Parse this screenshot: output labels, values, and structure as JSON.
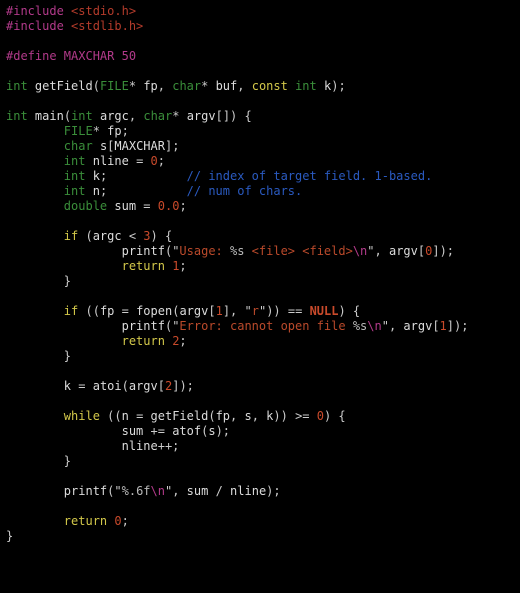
{
  "tokens": [
    [
      [
        "tok-pre",
        "#include "
      ],
      [
        "tok-inc",
        "<stdio.h>"
      ]
    ],
    [
      [
        "tok-pre",
        "#include "
      ],
      [
        "tok-inc",
        "<stdlib.h>"
      ]
    ],
    [],
    [
      [
        "tok-pre",
        "#define MAXCHAR 50"
      ]
    ],
    [],
    [
      [
        "tok-type",
        "int"
      ],
      [
        "tok-punc",
        " "
      ],
      [
        "tok-func",
        "getField"
      ],
      [
        "tok-punc",
        "("
      ],
      [
        "tok-type",
        "FILE"
      ],
      [
        "tok-punc",
        "* "
      ],
      [
        "tok-ident",
        "fp"
      ],
      [
        "tok-punc",
        ", "
      ],
      [
        "tok-type",
        "char"
      ],
      [
        "tok-punc",
        "* "
      ],
      [
        "tok-ident",
        "buf"
      ],
      [
        "tok-punc",
        ", "
      ],
      [
        "tok-kw",
        "const"
      ],
      [
        "tok-punc",
        " "
      ],
      [
        "tok-type",
        "int"
      ],
      [
        "tok-punc",
        " "
      ],
      [
        "tok-ident",
        "k"
      ],
      [
        "tok-punc",
        ");"
      ]
    ],
    [],
    [
      [
        "tok-type",
        "int"
      ],
      [
        "tok-punc",
        " "
      ],
      [
        "tok-func",
        "main"
      ],
      [
        "tok-punc",
        "("
      ],
      [
        "tok-type",
        "int"
      ],
      [
        "tok-punc",
        " "
      ],
      [
        "tok-ident",
        "argc"
      ],
      [
        "tok-punc",
        ", "
      ],
      [
        "tok-type",
        "char"
      ],
      [
        "tok-punc",
        "* "
      ],
      [
        "tok-ident",
        "argv"
      ],
      [
        "tok-punc",
        "[]) {"
      ]
    ],
    [
      [
        "tok-punc",
        "        "
      ],
      [
        "tok-type",
        "FILE"
      ],
      [
        "tok-punc",
        "* "
      ],
      [
        "tok-ident",
        "fp"
      ],
      [
        "tok-punc",
        ";"
      ]
    ],
    [
      [
        "tok-punc",
        "        "
      ],
      [
        "tok-type",
        "char"
      ],
      [
        "tok-punc",
        " "
      ],
      [
        "tok-ident",
        "s"
      ],
      [
        "tok-punc",
        "["
      ],
      [
        "tok-ident",
        "MAXCHAR"
      ],
      [
        "tok-punc",
        "];"
      ]
    ],
    [
      [
        "tok-punc",
        "        "
      ],
      [
        "tok-type",
        "int"
      ],
      [
        "tok-punc",
        " "
      ],
      [
        "tok-ident",
        "nline"
      ],
      [
        "tok-punc",
        " = "
      ],
      [
        "tok-num",
        "0"
      ],
      [
        "tok-punc",
        ";"
      ]
    ],
    [
      [
        "tok-punc",
        "        "
      ],
      [
        "tok-type",
        "int"
      ],
      [
        "tok-punc",
        " "
      ],
      [
        "tok-ident",
        "k"
      ],
      [
        "tok-punc",
        ";           "
      ],
      [
        "tok-cmt",
        "// index of target field. 1-based."
      ]
    ],
    [
      [
        "tok-punc",
        "        "
      ],
      [
        "tok-type",
        "int"
      ],
      [
        "tok-punc",
        " "
      ],
      [
        "tok-ident",
        "n"
      ],
      [
        "tok-punc",
        ";           "
      ],
      [
        "tok-cmt",
        "// num of chars."
      ]
    ],
    [
      [
        "tok-punc",
        "        "
      ],
      [
        "tok-type",
        "double"
      ],
      [
        "tok-punc",
        " "
      ],
      [
        "tok-ident",
        "sum"
      ],
      [
        "tok-punc",
        " = "
      ],
      [
        "tok-num",
        "0.0"
      ],
      [
        "tok-punc",
        ";"
      ]
    ],
    [],
    [
      [
        "tok-punc",
        "        "
      ],
      [
        "tok-kw",
        "if"
      ],
      [
        "tok-punc",
        " ("
      ],
      [
        "tok-ident",
        "argc"
      ],
      [
        "tok-punc",
        " < "
      ],
      [
        "tok-num",
        "3"
      ],
      [
        "tok-punc",
        ") {"
      ]
    ],
    [
      [
        "tok-punc",
        "                "
      ],
      [
        "tok-func",
        "printf"
      ],
      [
        "tok-punc",
        "("
      ],
      [
        "tok-strq",
        "\""
      ],
      [
        "tok-str",
        "Usage: "
      ],
      [
        "tok-fmt",
        "%s"
      ],
      [
        "tok-str",
        " <file> <field>"
      ],
      [
        "tok-esc",
        "\\n"
      ],
      [
        "tok-strq",
        "\""
      ],
      [
        "tok-punc",
        ", "
      ],
      [
        "tok-ident",
        "argv"
      ],
      [
        "tok-punc",
        "["
      ],
      [
        "tok-num",
        "0"
      ],
      [
        "tok-punc",
        "]);"
      ]
    ],
    [
      [
        "tok-punc",
        "                "
      ],
      [
        "tok-kw",
        "return"
      ],
      [
        "tok-punc",
        " "
      ],
      [
        "tok-num",
        "1"
      ],
      [
        "tok-punc",
        ";"
      ]
    ],
    [
      [
        "tok-punc",
        "        }"
      ]
    ],
    [],
    [
      [
        "tok-punc",
        "        "
      ],
      [
        "tok-kw",
        "if"
      ],
      [
        "tok-punc",
        " (("
      ],
      [
        "tok-ident",
        "fp"
      ],
      [
        "tok-punc",
        " = "
      ],
      [
        "tok-func",
        "fopen"
      ],
      [
        "tok-punc",
        "("
      ],
      [
        "tok-ident",
        "argv"
      ],
      [
        "tok-punc",
        "["
      ],
      [
        "tok-num",
        "1"
      ],
      [
        "tok-punc",
        "], "
      ],
      [
        "tok-strq",
        "\""
      ],
      [
        "tok-str",
        "r"
      ],
      [
        "tok-strq",
        "\""
      ],
      [
        "tok-punc",
        ")) == "
      ],
      [
        "tok-null",
        "NULL"
      ],
      [
        "tok-punc",
        ") {"
      ]
    ],
    [
      [
        "tok-punc",
        "                "
      ],
      [
        "tok-func",
        "printf"
      ],
      [
        "tok-punc",
        "("
      ],
      [
        "tok-strq",
        "\""
      ],
      [
        "tok-str",
        "Error: cannot open file "
      ],
      [
        "tok-fmt",
        "%s"
      ],
      [
        "tok-esc",
        "\\n"
      ],
      [
        "tok-strq",
        "\""
      ],
      [
        "tok-punc",
        ", "
      ],
      [
        "tok-ident",
        "argv"
      ],
      [
        "tok-punc",
        "["
      ],
      [
        "tok-num",
        "1"
      ],
      [
        "tok-punc",
        "]);"
      ]
    ],
    [
      [
        "tok-punc",
        "                "
      ],
      [
        "tok-kw",
        "return"
      ],
      [
        "tok-punc",
        " "
      ],
      [
        "tok-num",
        "2"
      ],
      [
        "tok-punc",
        ";"
      ]
    ],
    [
      [
        "tok-punc",
        "        }"
      ]
    ],
    [],
    [
      [
        "tok-punc",
        "        "
      ],
      [
        "tok-ident",
        "k"
      ],
      [
        "tok-punc",
        " = "
      ],
      [
        "tok-func",
        "atoi"
      ],
      [
        "tok-punc",
        "("
      ],
      [
        "tok-ident",
        "argv"
      ],
      [
        "tok-punc",
        "["
      ],
      [
        "tok-num",
        "2"
      ],
      [
        "tok-punc",
        "]);"
      ]
    ],
    [],
    [
      [
        "tok-punc",
        "        "
      ],
      [
        "tok-kw",
        "while"
      ],
      [
        "tok-punc",
        " (("
      ],
      [
        "tok-ident",
        "n"
      ],
      [
        "tok-punc",
        " = "
      ],
      [
        "tok-func",
        "getField"
      ],
      [
        "tok-punc",
        "("
      ],
      [
        "tok-ident",
        "fp"
      ],
      [
        "tok-punc",
        ", "
      ],
      [
        "tok-ident",
        "s"
      ],
      [
        "tok-punc",
        ", "
      ],
      [
        "tok-ident",
        "k"
      ],
      [
        "tok-punc",
        ")) >= "
      ],
      [
        "tok-num",
        "0"
      ],
      [
        "tok-punc",
        ") {"
      ]
    ],
    [
      [
        "tok-punc",
        "                "
      ],
      [
        "tok-ident",
        "sum"
      ],
      [
        "tok-punc",
        " += "
      ],
      [
        "tok-func",
        "atof"
      ],
      [
        "tok-punc",
        "("
      ],
      [
        "tok-ident",
        "s"
      ],
      [
        "tok-punc",
        ");"
      ]
    ],
    [
      [
        "tok-punc",
        "                "
      ],
      [
        "tok-ident",
        "nline"
      ],
      [
        "tok-punc",
        "++;"
      ]
    ],
    [
      [
        "tok-punc",
        "        }"
      ]
    ],
    [],
    [
      [
        "tok-punc",
        "        "
      ],
      [
        "tok-func",
        "printf"
      ],
      [
        "tok-punc",
        "("
      ],
      [
        "tok-strq",
        "\""
      ],
      [
        "tok-fmt",
        "%.6f"
      ],
      [
        "tok-esc",
        "\\n"
      ],
      [
        "tok-strq",
        "\""
      ],
      [
        "tok-punc",
        ", "
      ],
      [
        "tok-ident",
        "sum"
      ],
      [
        "tok-punc",
        " / "
      ],
      [
        "tok-ident",
        "nline"
      ],
      [
        "tok-punc",
        ");"
      ]
    ],
    [],
    [
      [
        "tok-punc",
        "        "
      ],
      [
        "tok-kw",
        "return"
      ],
      [
        "tok-punc",
        " "
      ],
      [
        "tok-num",
        "0"
      ],
      [
        "tok-punc",
        ";"
      ]
    ],
    [
      [
        "tok-punc",
        "}"
      ]
    ]
  ]
}
